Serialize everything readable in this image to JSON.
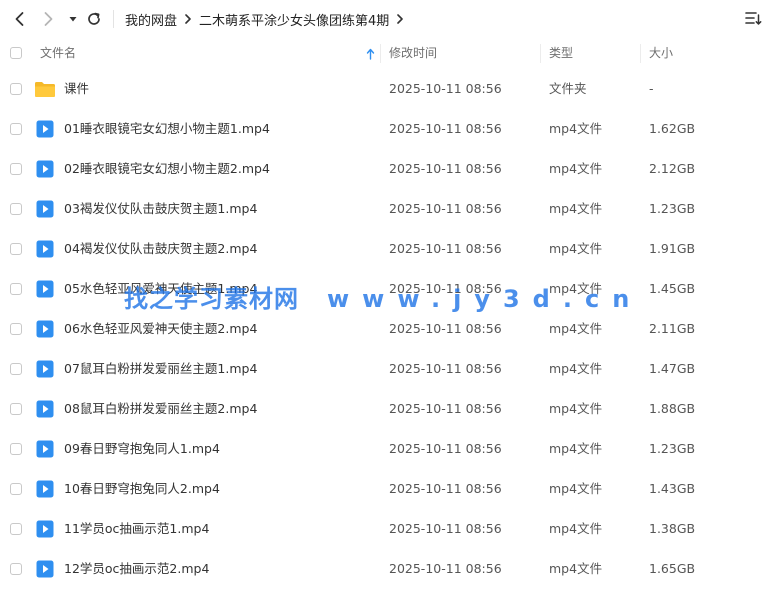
{
  "breadcrumb": {
    "items": [
      "我的网盘",
      "二木萌系平涂少女头像团练第4期"
    ]
  },
  "columns": {
    "name": "文件名",
    "modified": "修改时间",
    "type": "类型",
    "size": "大小"
  },
  "sort": {
    "column": "name",
    "direction": "ascending"
  },
  "colors": {
    "folder": "#f5b929",
    "video": "#2f8ff0",
    "watermark": "#1870e6"
  },
  "files": [
    {
      "name": "课件",
      "modified": "2025-10-11 08:56",
      "type": "文件夹",
      "size": "-",
      "icon": "folder-icon"
    },
    {
      "name": "01睡衣眼镜宅女幻想小物主题1.mp4",
      "modified": "2025-10-11 08:56",
      "type": "mp4文件",
      "size": "1.62GB",
      "icon": "video-file-icon"
    },
    {
      "name": "02睡衣眼镜宅女幻想小物主题2.mp4",
      "modified": "2025-10-11 08:56",
      "type": "mp4文件",
      "size": "2.12GB",
      "icon": "video-file-icon"
    },
    {
      "name": "03褐发仪仗队击鼓庆贺主题1.mp4",
      "modified": "2025-10-11 08:56",
      "type": "mp4文件",
      "size": "1.23GB",
      "icon": "video-file-icon"
    },
    {
      "name": "04褐发仪仗队击鼓庆贺主题2.mp4",
      "modified": "2025-10-11 08:56",
      "type": "mp4文件",
      "size": "1.91GB",
      "icon": "video-file-icon"
    },
    {
      "name": "05水色轻亚风爱神天使主题1.mp4",
      "modified": "2025-10-11 08:56",
      "type": "mp4文件",
      "size": "1.45GB",
      "icon": "video-file-icon"
    },
    {
      "name": "06水色轻亚风爱神天使主题2.mp4",
      "modified": "2025-10-11 08:56",
      "type": "mp4文件",
      "size": "2.11GB",
      "icon": "video-file-icon"
    },
    {
      "name": "07鼠耳白粉拼发爱丽丝主题1.mp4",
      "modified": "2025-10-11 08:56",
      "type": "mp4文件",
      "size": "1.47GB",
      "icon": "video-file-icon"
    },
    {
      "name": "08鼠耳白粉拼发爱丽丝主题2.mp4",
      "modified": "2025-10-11 08:56",
      "type": "mp4文件",
      "size": "1.88GB",
      "icon": "video-file-icon"
    },
    {
      "name": "09春日野穹抱兔同人1.mp4",
      "modified": "2025-10-11 08:56",
      "type": "mp4文件",
      "size": "1.23GB",
      "icon": "video-file-icon"
    },
    {
      "name": "10春日野穹抱兔同人2.mp4",
      "modified": "2025-10-11 08:56",
      "type": "mp4文件",
      "size": "1.43GB",
      "icon": "video-file-icon"
    },
    {
      "name": "11学员oc抽画示范1.mp4",
      "modified": "2025-10-11 08:56",
      "type": "mp4文件",
      "size": "1.38GB",
      "icon": "video-file-icon"
    },
    {
      "name": "12学员oc抽画示范2.mp4",
      "modified": "2025-10-11 08:56",
      "type": "mp4文件",
      "size": "1.65GB",
      "icon": "video-file-icon"
    }
  ],
  "watermark": {
    "name": "找之学习素材网",
    "url": "www.jy3d.cn"
  }
}
